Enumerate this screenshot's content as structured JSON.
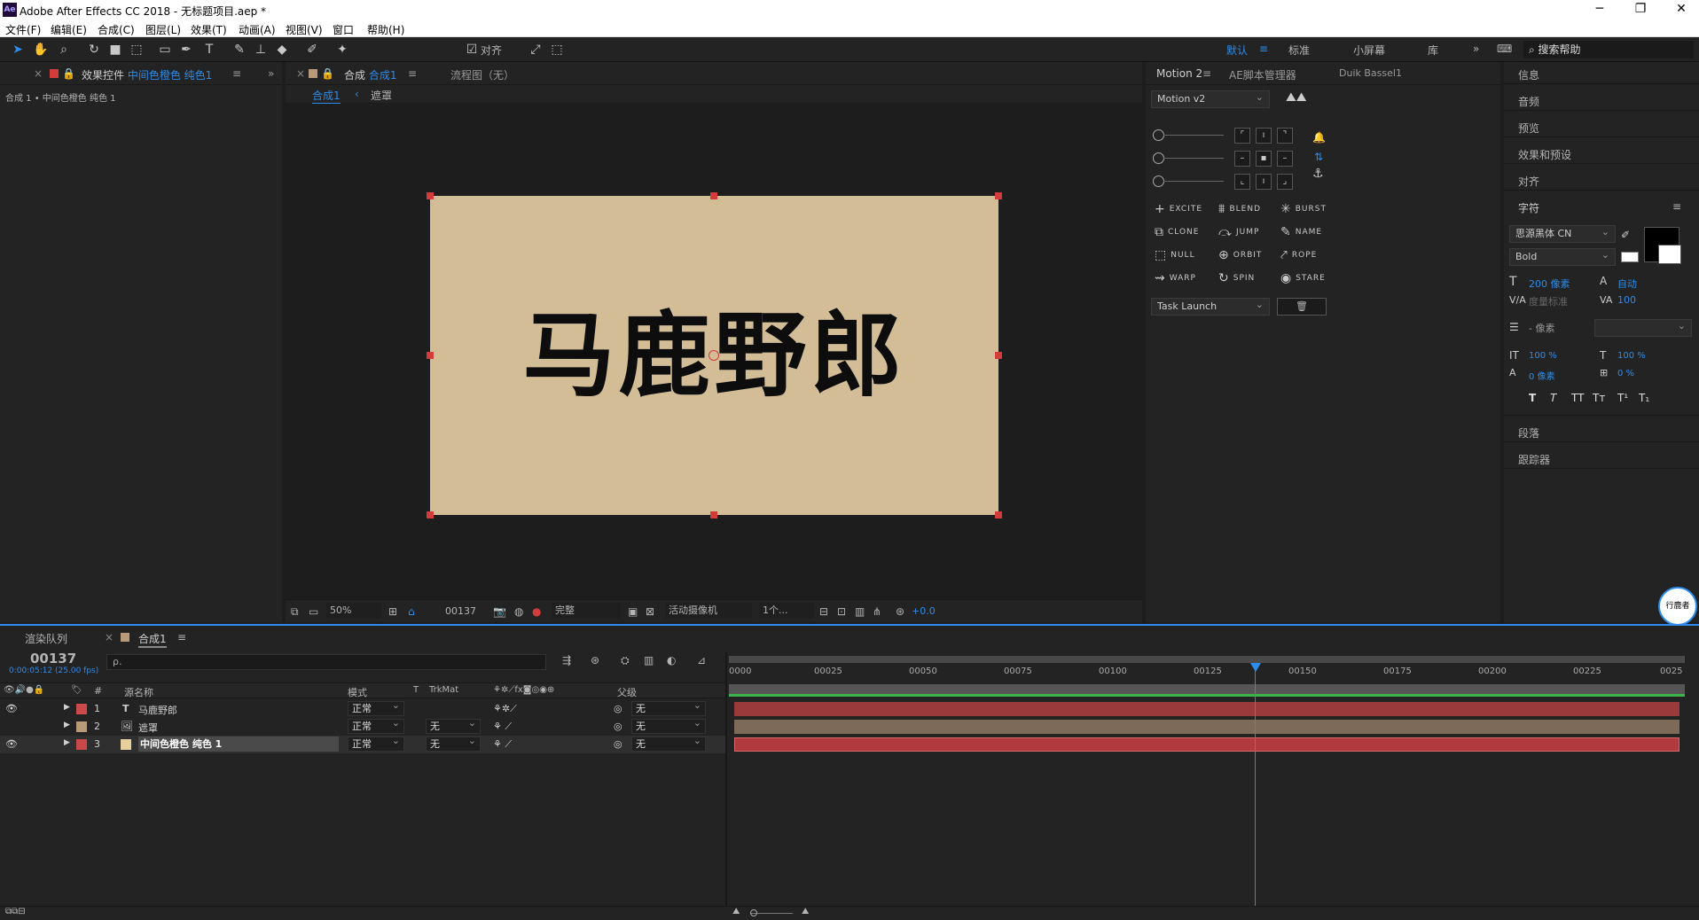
{
  "window": {
    "title": "Adobe After Effects CC 2018 - 无标题项目.aep *",
    "app_icon": "Ae",
    "minimize": "─",
    "maximize": "❐",
    "close": "✕"
  },
  "menu": [
    "文件(F)",
    "编辑(E)",
    "合成(C)",
    "图层(L)",
    "效果(T)",
    "动画(A)",
    "视图(V)",
    "窗口",
    "帮助(H)"
  ],
  "toolbar": {
    "snap_label": "对齐",
    "workspaces": [
      "默认",
      "标准",
      "小屏幕",
      "库"
    ],
    "active_workspace": "默认",
    "search_placeholder": "搜索帮助"
  },
  "effect_panel": {
    "tab_label": "效果控件",
    "tab_target": "中间色橙色 纯色1",
    "breadcrumb": "合成 1 • 中间色橙色 纯色 1"
  },
  "comp_panel": {
    "tab_prefix": "合成",
    "tab_name": "合成1",
    "flow_tab": "流程图（无）",
    "subtab_comp": "合成1",
    "subtab_mask": "遮罩",
    "canvas_text": "马鹿野郎",
    "canvas_color": "#d2bd96",
    "zoom": "50%",
    "timecode": "00137",
    "resolution": "完整",
    "camera": "活动摄像机",
    "views": "1个...",
    "exposure": "+0.0"
  },
  "motion_panel": {
    "tabs": [
      "Motion 2",
      "AE脚本管理器",
      "Duik Bassel1"
    ],
    "dropdown": "Motion v2",
    "buttons": [
      {
        "label": "EXCITE",
        "icon": "+"
      },
      {
        "label": "BLEND",
        "icon": "⩩"
      },
      {
        "label": "BURST",
        "icon": "✳"
      },
      {
        "label": "CLONE",
        "icon": "⧉"
      },
      {
        "label": "JUMP",
        "icon": "⤼"
      },
      {
        "label": "NAME",
        "icon": "✎"
      },
      {
        "label": "NULL",
        "icon": "⬚"
      },
      {
        "label": "ORBIT",
        "icon": "⊕"
      },
      {
        "label": "ROPE",
        "icon": "⤤"
      },
      {
        "label": "WARP",
        "icon": "⇝"
      },
      {
        "label": "SPIN",
        "icon": "↻"
      },
      {
        "label": "STARE",
        "icon": "◉"
      }
    ],
    "task_dropdown": "Task Launch",
    "trash_icon": "🗑"
  },
  "right_panel": {
    "sections_top": [
      "信息",
      "音频",
      "预览",
      "效果和预设",
      "对齐"
    ],
    "char_title": "字符",
    "font_family": "思源黑体 CN",
    "font_style": "Bold",
    "font_size": "200 像素",
    "leading": "自动",
    "kerning": "度量标准",
    "tracking": "100",
    "stroke_width": "- 像素",
    "vscale": "100 %",
    "hscale": "100 %",
    "baseline": "0 像素",
    "tsume": "0 %",
    "style_buttons": [
      "T",
      "T",
      "TT",
      "Tт",
      "T¹",
      "T₁"
    ],
    "sections_bottom": [
      "段落",
      "跟踪器"
    ],
    "logo_text": "行鹿者"
  },
  "timeline": {
    "tab_render": "渲染队列",
    "tab_comp": "合成1",
    "timecode": "00137",
    "timecode_sub": "0:00:05:12 (25.00 fps)",
    "search_placeholder": "ρ.",
    "col_name": "源名称",
    "col_mode": "模式",
    "col_t": "T",
    "col_trkmat": "TrkMat",
    "col_parent": "父级",
    "col_num": "#",
    "ruler_ticks": [
      "0000",
      "00025",
      "00050",
      "00075",
      "00100",
      "00125",
      "00150",
      "00175",
      "00200",
      "00225",
      "0025"
    ],
    "layers": [
      {
        "num": "1",
        "type": "T",
        "name": "马鹿野郎",
        "mode": "正常",
        "trkmat": "",
        "parent": "无",
        "label_color": "#c84a4a",
        "bar_color": "#9b3a3a"
      },
      {
        "num": "2",
        "type": "img",
        "name": "遮罩",
        "mode": "正常",
        "trkmat": "无",
        "parent": "无",
        "label_color": "#b89a78",
        "bar_color": "#7d6a58"
      },
      {
        "num": "3",
        "type": "solid",
        "name": "中间色橙色 纯色 1",
        "mode": "正常",
        "trkmat": "无",
        "parent": "无",
        "label_color": "#c84a4a",
        "bar_color": "#b03a3e"
      }
    ]
  }
}
